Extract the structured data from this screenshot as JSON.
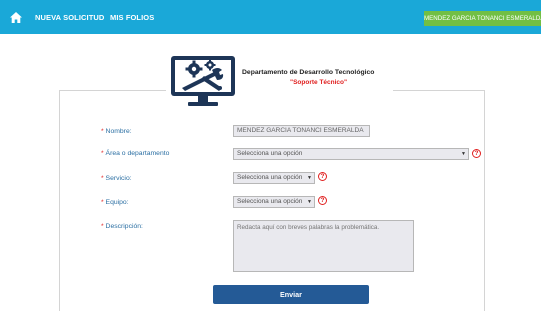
{
  "nav": {
    "home_icon": "home-icon",
    "links": [
      "NUEVA SOLICITUD",
      "MIS FOLIOS"
    ],
    "user": "MENDEZ GARCIA TONANCI ESMERALDA"
  },
  "header": {
    "logo_icon": "monitor-gears-tools-icon",
    "title": "Departamento de Desarrollo Tecnológico",
    "subtitle": "\"Soporte Técnico\""
  },
  "form": {
    "required_mark": "*",
    "nombre": {
      "label": "Nombre:",
      "value": "MENDEZ GARCIA TONANCI ESMERALDA"
    },
    "area": {
      "label": "Área o departamento",
      "value": "Selecciona una opción"
    },
    "servicio": {
      "label": "Servicio:",
      "value": "Selecciona una opción"
    },
    "equipo": {
      "label": "Equipo:",
      "value": "Selecciona una opción"
    },
    "descripcion": {
      "label": "Descripción:",
      "placeholder": "Redacta aquí con breves palabras la problemática."
    },
    "help_glyph": "?",
    "submit_label": "Enviar"
  },
  "colors": {
    "navbar": "#1aa8d8",
    "user_badge": "#72bf44",
    "label_text": "#2b6fa3",
    "required": "#e02020",
    "submit": "#245a96"
  }
}
